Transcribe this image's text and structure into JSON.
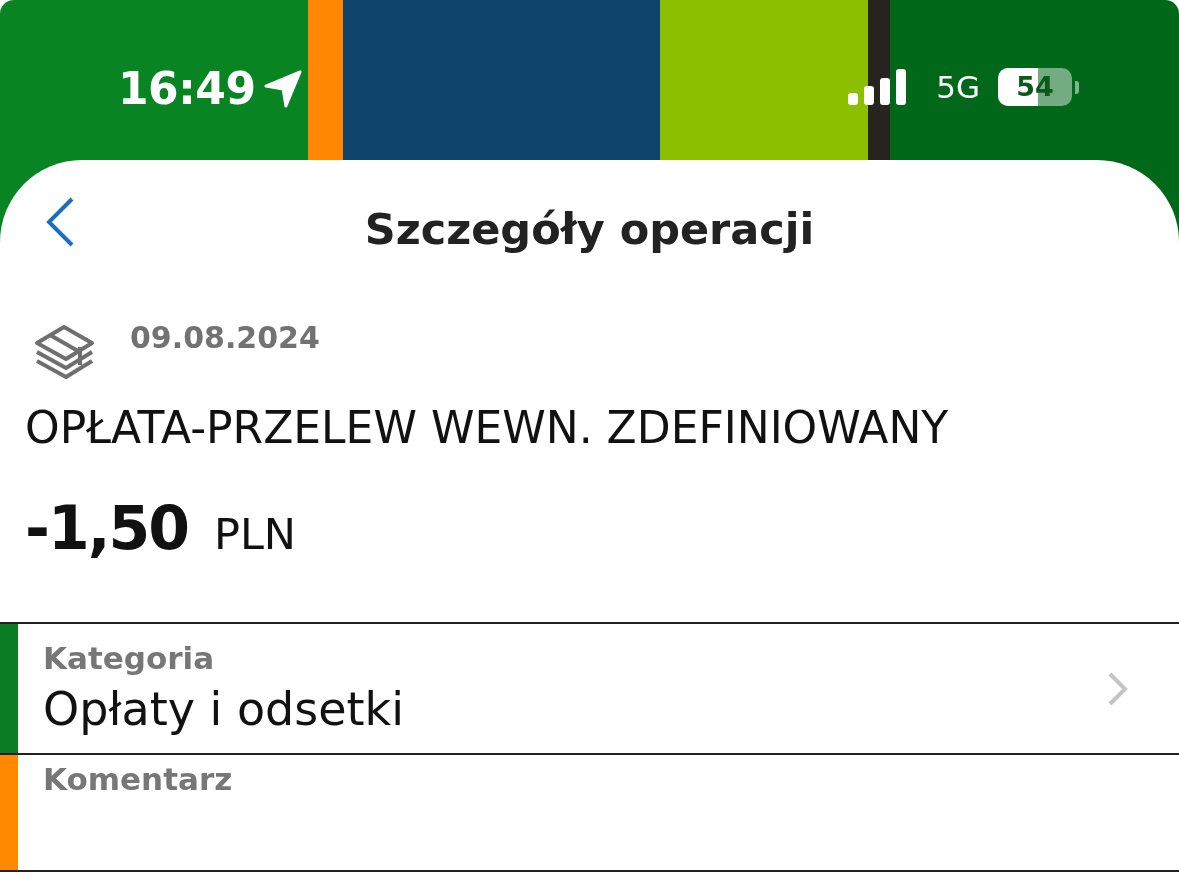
{
  "status_bar": {
    "time": "16:49",
    "network": "5G",
    "battery": "54"
  },
  "header": {
    "title": "Szczegóły operacji"
  },
  "operation": {
    "date": "09.08.2024",
    "description": "OPŁATA-PRZELEW WEWN. ZDEFINIOWANY",
    "amount": "-1,50",
    "currency": "PLN"
  },
  "details": [
    {
      "kind": "select",
      "label": "Kategoria",
      "value": "Opłaty i odsetki",
      "color": "#0a7d24"
    },
    {
      "kind": "text",
      "label": "Komentarz",
      "color": "#ff8a00"
    }
  ]
}
